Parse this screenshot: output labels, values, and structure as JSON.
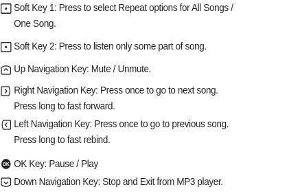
{
  "keys": [
    {
      "icon": "soft-key-1-icon",
      "lines": [
        "Soft Key 1: Press to select Repeat options for All Songs /",
        "One Song."
      ]
    },
    {
      "icon": "soft-key-2-icon",
      "lines": [
        "Soft Key 2: Press to listen only some part of song."
      ]
    },
    {
      "icon": "up-navigation-key-icon",
      "lines": [
        "Up Navigation Key: Mute / Unmute."
      ]
    },
    {
      "icon": "right-navigation-key-icon",
      "lines": [
        "Right Navigation Key: Press once to go to next song.",
        "Press long to fast forward."
      ]
    },
    {
      "icon": "left-navigation-key-icon",
      "lines": [
        "Left Navigation Key: Press once to go to previous song.",
        "Press long to fast rebind."
      ]
    },
    {
      "icon": "ok-key-icon",
      "icon_text": "OK",
      "lines": [
        "OK Key: Pause / Play"
      ]
    },
    {
      "icon": "down-navigation-key-icon",
      "lines": [
        "Down Navigation Key: Stop and Exit from MP3 player."
      ]
    }
  ]
}
